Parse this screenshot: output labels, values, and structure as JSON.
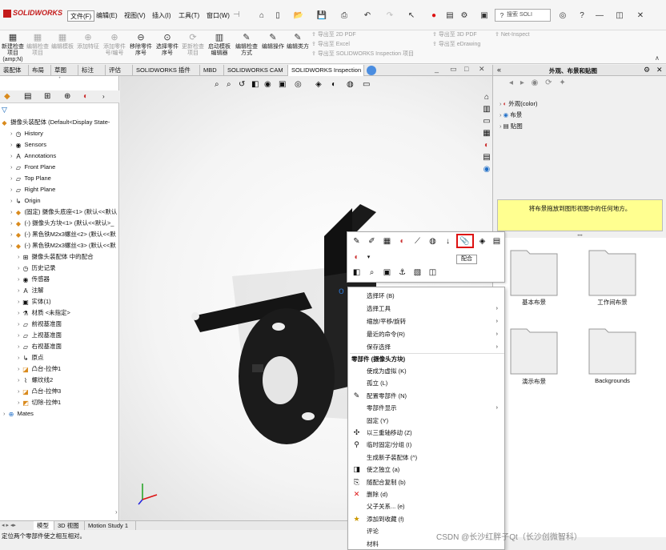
{
  "app": {
    "brand": "SOLIDWORKS",
    "menus": [
      "文件(F)",
      "编辑(E)",
      "视图(V)",
      "插入(I)",
      "工具(T)",
      "窗口(W)"
    ],
    "search_placeholder": "搜索 SOLI"
  },
  "command_manager": {
    "buttons": [
      {
        "label": "新建检查项目 (amp;N)",
        "icon": "new-inspection-icon",
        "enabled": true
      },
      {
        "label": "编辑检查项目",
        "icon": "edit-inspection-icon",
        "enabled": false
      },
      {
        "label": "编辑模板",
        "icon": "edit-template-icon",
        "enabled": false
      },
      {
        "label": "添加特征",
        "icon": "add-feature-icon",
        "enabled": false
      },
      {
        "label": "添加零件号/编号",
        "icon": "add-part-number-icon",
        "enabled": false
      },
      {
        "label": "移除零件序号",
        "icon": "remove-balloon-icon",
        "enabled": true
      },
      {
        "label": "选择零件序号",
        "icon": "select-balloon-icon",
        "enabled": true
      },
      {
        "label": "更新检查项目",
        "icon": "update-inspection-icon",
        "enabled": false
      },
      {
        "label": "启动模板编辑器",
        "icon": "template-editor-icon",
        "enabled": true
      },
      {
        "label": "编辑检查方式",
        "icon": "edit-method-icon",
        "enabled": true
      },
      {
        "label": "编辑操作",
        "icon": "edit-operation-icon",
        "enabled": true
      },
      {
        "label": "编辑类方",
        "icon": "edit-class-icon",
        "enabled": true
      }
    ],
    "export_items": [
      "导出至 2D PDF",
      "导出至 Excel",
      "导出至 SOLIDWORKS Inspection 项目"
    ],
    "export_items2": [
      "导出至 3D PDF",
      "导出至 eDrawing"
    ],
    "net_inspect": "Net-Inspect"
  },
  "tabs": [
    "装配体",
    "布局",
    "草图",
    "标注",
    "评估",
    "SOLIDWORKS 插件",
    "MBD",
    "SOLIDWORKS CAM",
    "SOLIDWORKS Inspection"
  ],
  "active_tab": "SOLIDWORKS Inspection",
  "tree": {
    "root": "摄像头装配体  (Default<Display State-",
    "items": [
      {
        "label": "History",
        "icon": "history-icon",
        "indent": 1
      },
      {
        "label": "Sensors",
        "icon": "sensor-icon",
        "indent": 1
      },
      {
        "label": "Annotations",
        "icon": "annotation-icon",
        "indent": 1
      },
      {
        "label": "Front Plane",
        "icon": "plane-icon",
        "indent": 1
      },
      {
        "label": "Top Plane",
        "icon": "plane-icon",
        "indent": 1
      },
      {
        "label": "Right Plane",
        "icon": "plane-icon",
        "indent": 1
      },
      {
        "label": "Origin",
        "icon": "origin-icon",
        "indent": 1
      },
      {
        "label": "(固定) 摄像头底座<1> (默认<<默认",
        "icon": "part-icon",
        "indent": 1
      },
      {
        "label": "(-) 摄像头方块<1> (默认<<默认>_",
        "icon": "part-icon",
        "indent": 1
      },
      {
        "label": "(-) 黑色铁M2x3螺丝<2> (默认<<默",
        "icon": "part-icon",
        "indent": 1
      },
      {
        "label": "(-) 黑色铁M2x3螺丝<3> (默认<<默",
        "icon": "part-icon",
        "indent": 1
      },
      {
        "label": "摄像头装配体 中的配合",
        "icon": "mates-folder-icon",
        "indent": 2
      },
      {
        "label": "历史记录",
        "icon": "history-icon",
        "indent": 2
      },
      {
        "label": "传感器",
        "icon": "sensor-icon",
        "indent": 2
      },
      {
        "label": "注解",
        "icon": "annotation-icon",
        "indent": 2
      },
      {
        "label": "实体(1)",
        "icon": "solid-body-icon",
        "indent": 2
      },
      {
        "label": "材质 <未指定>",
        "icon": "material-icon",
        "indent": 2
      },
      {
        "label": "前视基准面",
        "icon": "plane-icon",
        "indent": 2
      },
      {
        "label": "上视基准面",
        "icon": "plane-icon",
        "indent": 2
      },
      {
        "label": "右视基准面",
        "icon": "plane-icon",
        "indent": 2
      },
      {
        "label": "原点",
        "icon": "origin-icon",
        "indent": 2
      },
      {
        "label": "凸台-拉伸1",
        "icon": "extrude-icon",
        "indent": 2
      },
      {
        "label": "螺纹线2",
        "icon": "thread-icon",
        "indent": 2
      },
      {
        "label": "凸台-拉伸3",
        "icon": "extrude-icon",
        "indent": 2
      },
      {
        "label": "切除-拉伸1",
        "icon": "cut-extrude-icon",
        "indent": 2
      },
      {
        "label": "Mates",
        "icon": "mates-icon",
        "indent": 0
      }
    ]
  },
  "bottom_tabs": [
    "模型",
    "3D 视图",
    "Motion Study 1"
  ],
  "status": "定位两个零部件使之相互相对。",
  "right_panel": {
    "title": "外观、布景和贴图",
    "tree": [
      "外观(color)",
      "布景",
      "贴图"
    ],
    "hint": "将布景拖放到图形视图中的任何地方。",
    "folders": [
      "基本布景",
      "工作间布景",
      "演示布景",
      "Backgrounds"
    ]
  },
  "context_toolbar": {
    "tooltip": "配合"
  },
  "context_menu": {
    "items1": [
      {
        "label": "选择环 (B)",
        "arrow": false
      },
      {
        "label": "选择工具",
        "arrow": true
      },
      {
        "label": "缩放/平移/旋转",
        "arrow": true
      },
      {
        "label": "最近的命令(R)",
        "arrow": true
      },
      {
        "label": "保存选择",
        "arrow": true
      }
    ],
    "section": "零部件 (摄像头方块)",
    "items2": [
      {
        "label": "使成为虚拟 (K)",
        "arrow": false,
        "icon": ""
      },
      {
        "label": "孤立 (L)",
        "arrow": false,
        "icon": ""
      },
      {
        "label": "配置零部件 (N)",
        "arrow": false,
        "icon": "configure-icon"
      },
      {
        "label": "零部件显示",
        "arrow": true,
        "icon": ""
      },
      {
        "label": "固定 (Y)",
        "arrow": false,
        "icon": ""
      },
      {
        "label": "以三重轴移动 (Z)",
        "arrow": false,
        "icon": "triad-icon"
      },
      {
        "label": "临时固定/分组 (I)",
        "arrow": false,
        "icon": "temp-fix-icon"
      },
      {
        "label": "生成新子装配体 (^)",
        "arrow": false,
        "icon": ""
      },
      {
        "label": "使之独立 (a)",
        "arrow": false,
        "icon": "independent-icon"
      },
      {
        "label": "随配合复制 (b)",
        "arrow": false,
        "icon": "copy-mates-icon"
      },
      {
        "label": "删除 (d)",
        "arrow": false,
        "icon": "delete-icon"
      },
      {
        "label": "父子关系... (e)",
        "arrow": false,
        "icon": ""
      },
      {
        "label": "添加到收藏 (f)",
        "arrow": false,
        "icon": "favorite-icon"
      },
      {
        "label": "评论",
        "arrow": false,
        "icon": ""
      },
      {
        "label": "材料",
        "arrow": false,
        "icon": ""
      }
    ]
  },
  "watermark": "CSDN @长沙红胖子Qt（长沙创微智科）"
}
